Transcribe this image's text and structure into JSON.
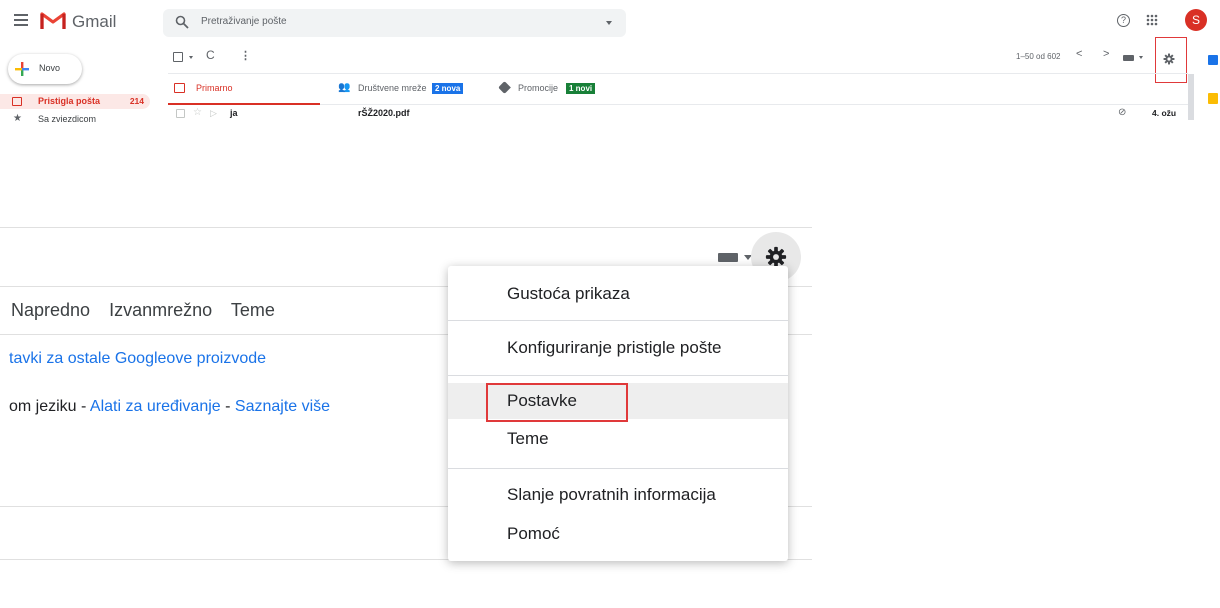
{
  "app": {
    "name": "Gmail"
  },
  "header": {
    "search_placeholder": "Pretraživanje pošte",
    "help_glyph": "?",
    "avatar_initial": "S"
  },
  "sidebar": {
    "compose_label": "Novo",
    "items": [
      {
        "label": "Pristigla pošta",
        "count": "214",
        "active": true
      },
      {
        "label": "Sa zvjezdicom"
      }
    ]
  },
  "toolbar": {
    "refresh_glyph": "C",
    "more_glyph": "⋮",
    "pager": "1–50 od 602",
    "prev_glyph": "<",
    "next_glyph": ">"
  },
  "tabs": [
    {
      "label": "Primarno",
      "active": true
    },
    {
      "label": "Društvene mreže",
      "badge": "2 nova"
    },
    {
      "label": "Promocije",
      "badge": "1 novi"
    }
  ],
  "email_row": {
    "sender": "ja",
    "subject": "rŠŽ2020.pdf",
    "date": "4. ožu"
  },
  "settings_page": {
    "tabs": [
      "Napredno",
      "Izvanmrežno",
      "Teme"
    ],
    "link_line": "tavki za ostale Googleove proizvode",
    "lang_prefix": "om jeziku - ",
    "lang_link1": "Alati za uređivanje",
    "lang_sep": " - ",
    "lang_link2": "Saznajte više"
  },
  "gear_menu": {
    "items": [
      "Gustoća prikaza",
      "Konfiguriranje pristigle pošte",
      "Postavke",
      "Teme",
      "Slanje povratnih informacija",
      "Pomoć"
    ],
    "highlighted": "Postavke"
  },
  "colors": {
    "accent_red": "#d93025",
    "highlight_box": "#e0393a",
    "link_blue": "#1a73e8",
    "badge_blue": "#1a73e8",
    "badge_green": "#188038"
  }
}
